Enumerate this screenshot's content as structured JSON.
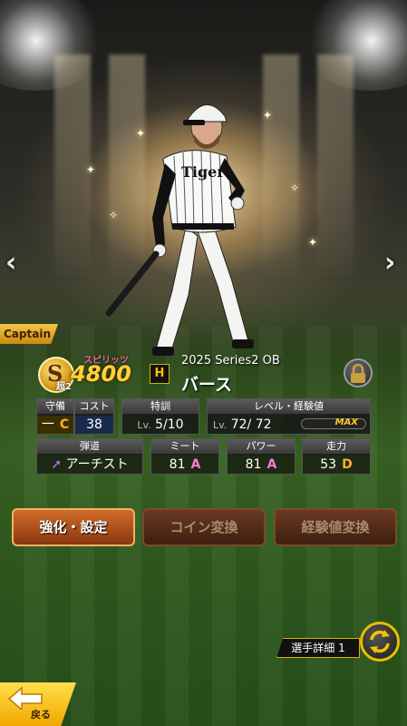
{
  "captain_label": "Captain",
  "card": {
    "rank_letter": "S",
    "rank_sub": "超2",
    "spirit_label": "スピリッツ",
    "spirit_value": "4800",
    "team_logo_text": "H",
    "series": "2025 Series2 OB",
    "player_name": "バース",
    "uniform_text": "Tiger"
  },
  "stats": {
    "position": {
      "label": "守備",
      "value": "一",
      "rank": "C"
    },
    "cost": {
      "label": "コスト",
      "value": "38"
    },
    "training": {
      "label": "特訓",
      "lv_prefix": "Lv.",
      "value": "5/10"
    },
    "level": {
      "label": "レベル・経験値",
      "lv_prefix": "Lv.",
      "value": "72/ 72",
      "bar_label": "MAX",
      "progress": 1.0
    },
    "trajectory": {
      "label": "弾道",
      "value": "アーチスト"
    },
    "meet": {
      "label": "ミート",
      "value": "81",
      "rank": "A"
    },
    "power": {
      "label": "パワー",
      "value": "81",
      "rank": "A"
    },
    "speed": {
      "label": "走力",
      "value": "53",
      "rank": "D"
    }
  },
  "buttons": {
    "enhance": "強化・設定",
    "coin_convert": "コイン変換",
    "exp_convert": "経験値変換",
    "details": "選手詳細 1",
    "back": "戻る"
  },
  "colors": {
    "accent_gold": "#f2c400",
    "rank_a": "#ff7ad0",
    "rank_d": "#ffb22a"
  },
  "icons": [
    "chevron-left-icon",
    "chevron-right-icon",
    "lock-icon",
    "swap-icon",
    "back-arrow-icon",
    "trajectory-arrow-icon"
  ]
}
